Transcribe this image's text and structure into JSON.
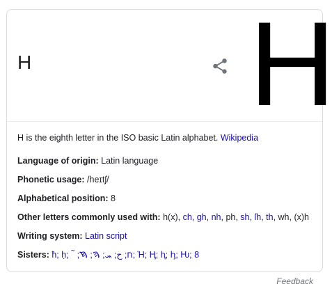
{
  "title": "H",
  "big_letter": "H",
  "share_icon": "share-icon",
  "description": {
    "text": "H is the eighth letter in the ISO basic Latin alphabet. ",
    "source": "Wikipedia"
  },
  "facts": {
    "language_of_origin": {
      "label": "Language of origin:",
      "value": "Latin language"
    },
    "phonetic_usage": {
      "label": "Phonetic usage:",
      "value": "/heɪtʃ/"
    },
    "alphabetical_position": {
      "label": "Alphabetical position:",
      "value": "8"
    },
    "other_letters": {
      "label": "Other letters commonly used with:",
      "items": [
        {
          "text": "h(x)",
          "link": false
        },
        {
          "text": "ch",
          "link": true
        },
        {
          "text": "gh",
          "link": true
        },
        {
          "text": "nh",
          "link": true
        },
        {
          "text": "ph",
          "link": false
        },
        {
          "text": "sh",
          "link": true
        },
        {
          "text": "ſh",
          "link": true
        },
        {
          "text": "th",
          "link": true
        },
        {
          "text": "wh",
          "link": false
        },
        {
          "text": "(x)h",
          "link": false
        }
      ]
    },
    "writing_system": {
      "label": "Writing system:",
      "value": "Latin script"
    },
    "sisters": {
      "label": "Sisters:",
      "value": "ħ; ḥ; ח; ح; ܚ; ࠄ; ࠇ; ࠚ; Ἡ; Ⱨ; ⱨ; ꞕ; Ƕ; 8"
    }
  },
  "feedback": "Feedback"
}
